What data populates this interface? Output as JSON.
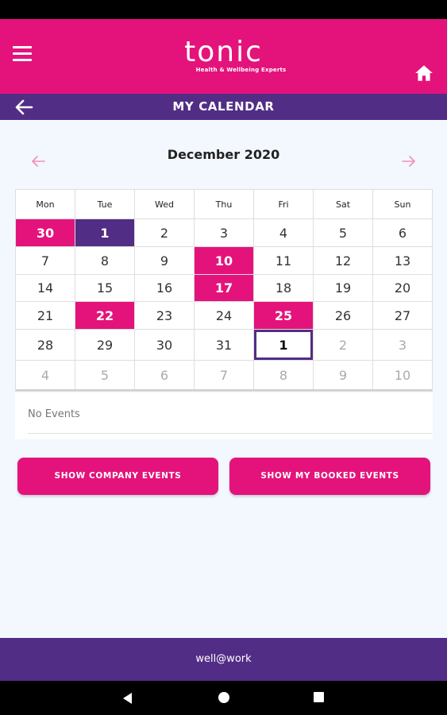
{
  "header": {
    "logo_text": "tonic",
    "logo_tagline": "Health & Wellbeing Experts",
    "menu_icon": "hamburger-menu-icon",
    "home_icon": "home-icon",
    "bg_color": "#e4137b"
  },
  "title_bar": {
    "back_icon": "arrow-left-icon",
    "title": "MY CALENDAR",
    "bg_color": "#522d86"
  },
  "calendar": {
    "month_label": "December 2020",
    "prev_icon": "arrow-left-icon",
    "next_icon": "arrow-right-icon",
    "weekdays": [
      "Mon",
      "Tue",
      "Wed",
      "Thu",
      "Fri",
      "Sat",
      "Sun"
    ],
    "weeks": [
      [
        {
          "label": "30",
          "state": "event"
        },
        {
          "label": "1",
          "state": "selected"
        },
        {
          "label": "2",
          "state": ""
        },
        {
          "label": "3",
          "state": ""
        },
        {
          "label": "4",
          "state": ""
        },
        {
          "label": "5",
          "state": ""
        },
        {
          "label": "6",
          "state": ""
        }
      ],
      [
        {
          "label": "7",
          "state": ""
        },
        {
          "label": "8",
          "state": ""
        },
        {
          "label": "9",
          "state": ""
        },
        {
          "label": "10",
          "state": "event"
        },
        {
          "label": "11",
          "state": ""
        },
        {
          "label": "12",
          "state": ""
        },
        {
          "label": "13",
          "state": ""
        }
      ],
      [
        {
          "label": "14",
          "state": ""
        },
        {
          "label": "15",
          "state": ""
        },
        {
          "label": "16",
          "state": ""
        },
        {
          "label": "17",
          "state": "event"
        },
        {
          "label": "18",
          "state": ""
        },
        {
          "label": "19",
          "state": ""
        },
        {
          "label": "20",
          "state": ""
        }
      ],
      [
        {
          "label": "21",
          "state": ""
        },
        {
          "label": "22",
          "state": "event"
        },
        {
          "label": "23",
          "state": ""
        },
        {
          "label": "24",
          "state": ""
        },
        {
          "label": "25",
          "state": "event"
        },
        {
          "label": "26",
          "state": ""
        },
        {
          "label": "27",
          "state": ""
        }
      ],
      [
        {
          "label": "28",
          "state": ""
        },
        {
          "label": "29",
          "state": ""
        },
        {
          "label": "30",
          "state": ""
        },
        {
          "label": "31",
          "state": ""
        },
        {
          "label": "1",
          "state": "today"
        },
        {
          "label": "2",
          "state": "other"
        },
        {
          "label": "3",
          "state": "other"
        }
      ],
      [
        {
          "label": "4",
          "state": "other"
        },
        {
          "label": "5",
          "state": "other"
        },
        {
          "label": "6",
          "state": "other"
        },
        {
          "label": "7",
          "state": "other"
        },
        {
          "label": "8",
          "state": "other"
        },
        {
          "label": "9",
          "state": "other"
        },
        {
          "label": "10",
          "state": "other"
        }
      ]
    ],
    "event_color": "#e4137b",
    "selected_color": "#522d86"
  },
  "events": {
    "empty_text": "No Events"
  },
  "buttons": {
    "company_events": "SHOW COMPANY EVENTS",
    "booked_events": "SHOW MY BOOKED EVENTS"
  },
  "footer": {
    "text": "well@work"
  },
  "system_nav": {
    "back_icon": "nav-back-triangle-icon",
    "home_icon": "nav-home-circle-icon",
    "recents_icon": "nav-recents-square-icon"
  }
}
